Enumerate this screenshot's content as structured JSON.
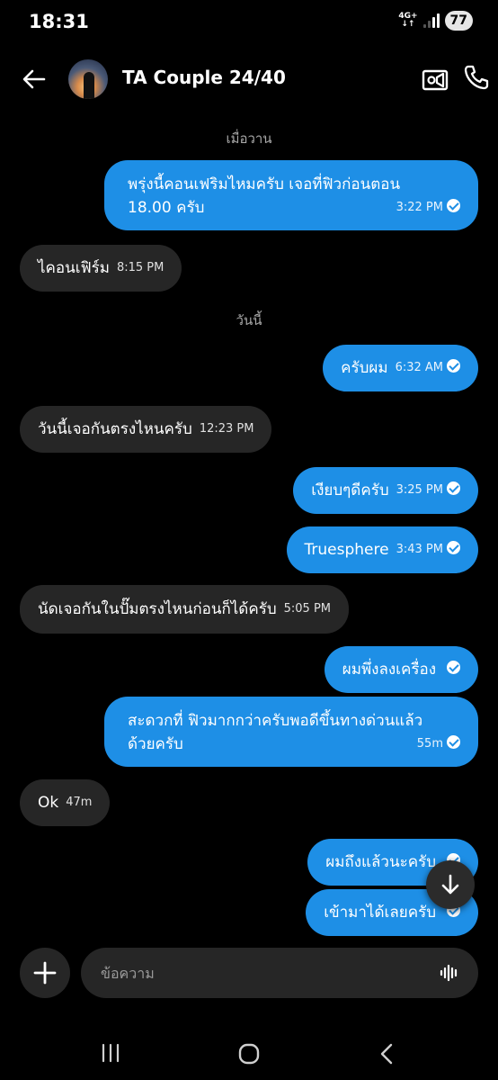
{
  "status": {
    "time": "18:31",
    "network_top": "4G+",
    "network_bottom": "↓↑",
    "battery": "77"
  },
  "header": {
    "title": "TA Couple 24/40"
  },
  "messages": [
    {
      "type": "date",
      "text": "เมื่อวาน"
    },
    {
      "dir": "out",
      "line1": "พรุ่งนี้คอนเฟริมไหมครับ เจอที่ฟิวก่อนตอน",
      "line2": "18.00 ครับ",
      "time": "3:22 PM"
    },
    {
      "dir": "in",
      "text": "ไคอนเฟิร์ม",
      "time": "8:15 PM"
    },
    {
      "type": "date",
      "text": "วันนี้"
    },
    {
      "dir": "out",
      "text": "ครับผม",
      "time": "6:32 AM"
    },
    {
      "dir": "in",
      "text": "วันนี้เจอกันตรงไหนครับ",
      "time": "12:23 PM"
    },
    {
      "dir": "out",
      "text": "เงียบๆดีครับ",
      "time": "3:25 PM"
    },
    {
      "dir": "out",
      "text": "Truesphere",
      "time": "3:43 PM"
    },
    {
      "dir": "in",
      "text": "นัดเจอกันในปั๊มตรงไหนก่อนก็ได้ครับ",
      "time": "5:05 PM"
    },
    {
      "dir": "out",
      "text": "ผมพึ่งลงเครื่อง",
      "time": ""
    },
    {
      "dir": "out",
      "line1": "สะดวกที่ ฟิวมากกว่าครับพอดีขึ้นทางด่วนแล้ว",
      "line2": "ด้วยครับ",
      "time": "55m"
    },
    {
      "dir": "in",
      "text": "Ok",
      "time": "47m"
    },
    {
      "dir": "out",
      "text": "ผมถึงแล้วนะครับ",
      "time": ""
    },
    {
      "dir": "out",
      "text": "เข้ามาได้เลยครับ",
      "time": ""
    }
  ],
  "composer": {
    "placeholder": "ข้อความ"
  },
  "colors": {
    "outgoing_bubble": "#1e8fe6",
    "incoming_bubble": "#262626",
    "background": "#000000"
  }
}
